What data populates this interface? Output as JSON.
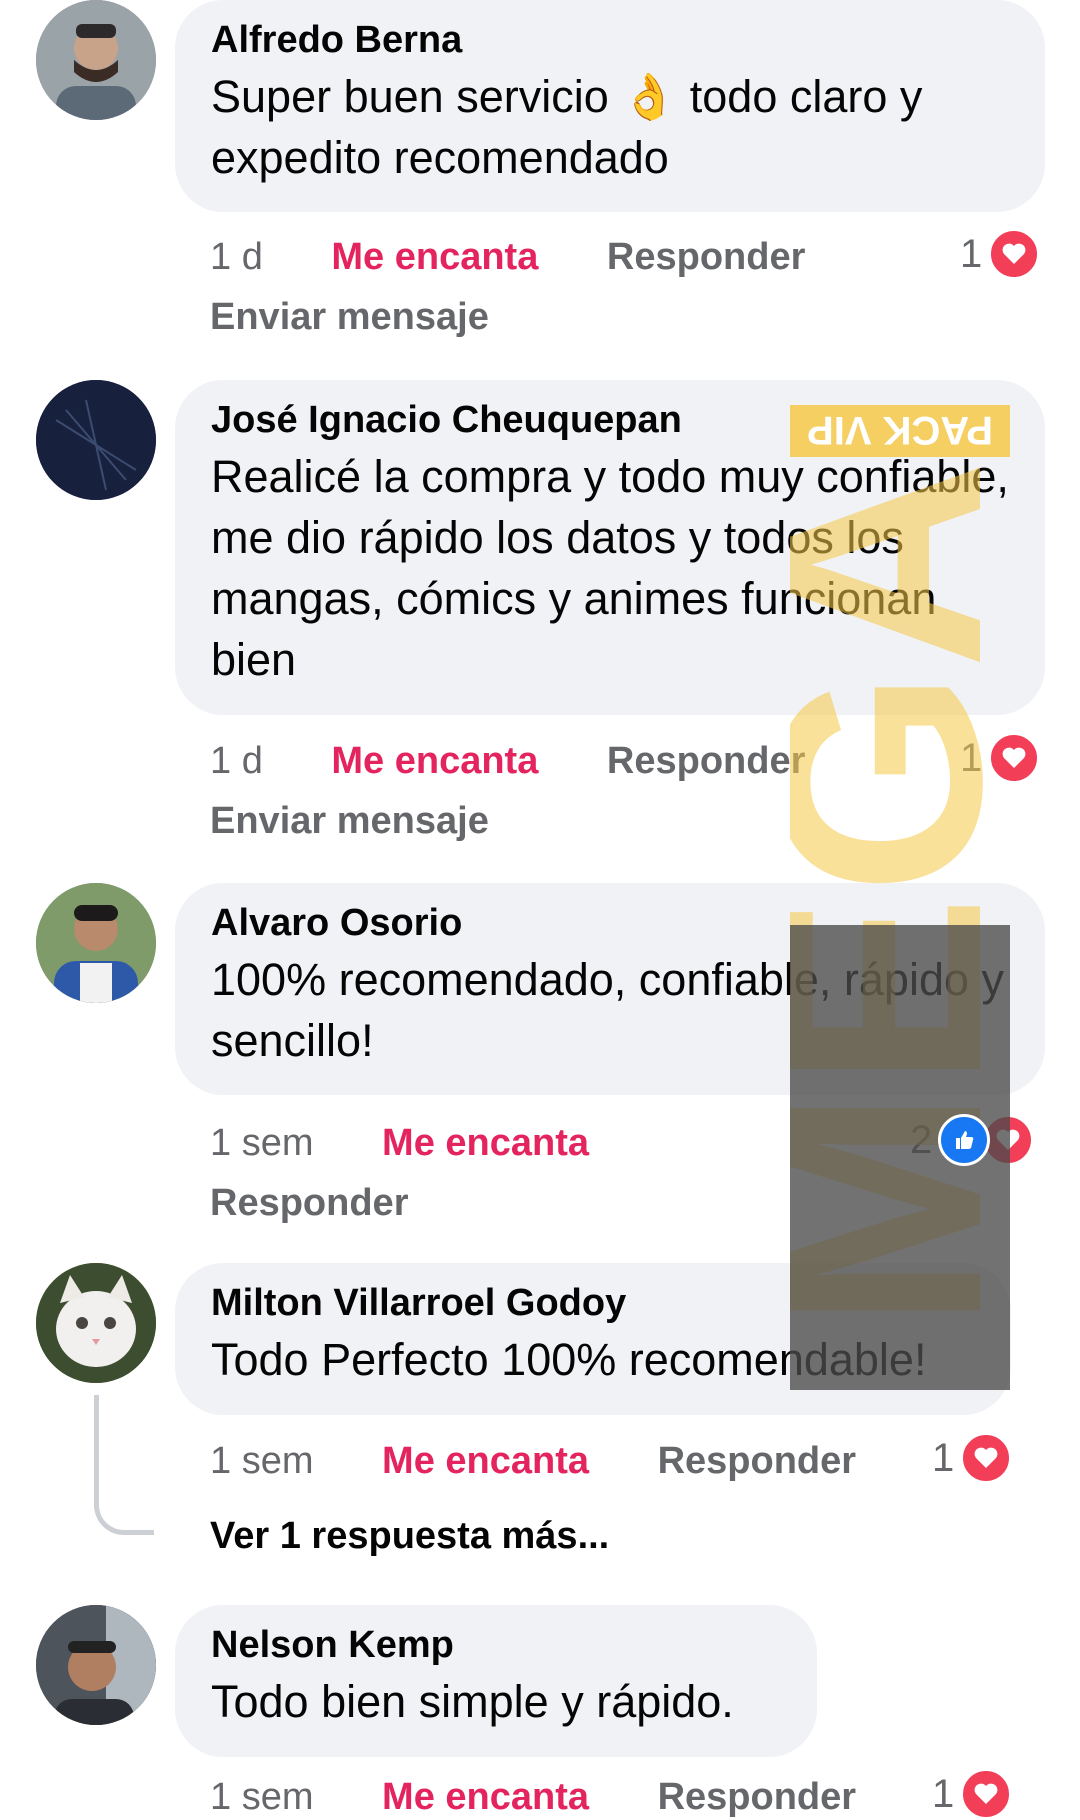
{
  "comments": [
    {
      "name": "Alfredo Berna",
      "text": "Super buen servicio 👌 todo claro y expedito recomendado",
      "time": "1 d",
      "love_label": "Me encanta",
      "reply_label": "Responder",
      "reactions": "1",
      "extra": "Enviar mensaje"
    },
    {
      "name": "José Ignacio Cheuquepan",
      "text": "Realicé la compra y todo muy confiable, me dio rápido los datos y todos los mangas, cómics y animes funcionan bien",
      "time": "1 d",
      "love_label": "Me encanta",
      "reply_label": "Responder",
      "reactions": "1",
      "extra": "Enviar mensaje"
    },
    {
      "name": "Alvaro Osorio",
      "text": "100% recomendado, confiable, rápido y sencillo!",
      "time": "1 sem",
      "love_label": "Me encanta",
      "reply_label": "Responder",
      "reactions": "2"
    },
    {
      "name": "Milton Villarroel Godoy",
      "text": "Todo Perfecto 100% recomendable!",
      "time": "1 sem",
      "love_label": "Me encanta",
      "reply_label": "Responder",
      "reactions": "1",
      "more_replies": "Ver 1 respuesta más..."
    },
    {
      "name": "Nelson Kemp",
      "text": "Todo bien simple y rápido.",
      "time": "1 sem",
      "love_label": "Me encanta",
      "reply_label": "Responder",
      "reactions": "1"
    }
  ],
  "watermark": {
    "top_text": "PACK VIP",
    "brand": "MEGA"
  },
  "colors": {
    "love": "#e4245e",
    "bubble": "#f0f2f5",
    "meta": "#65676b",
    "heart": "#f33e58",
    "like": "#1877f2",
    "watermark_yellow": "#f7c948",
    "watermark_gray": "#4a4a4a"
  },
  "icons": [
    "heart-reaction-icon",
    "like-reaction-icon",
    "avatar"
  ]
}
